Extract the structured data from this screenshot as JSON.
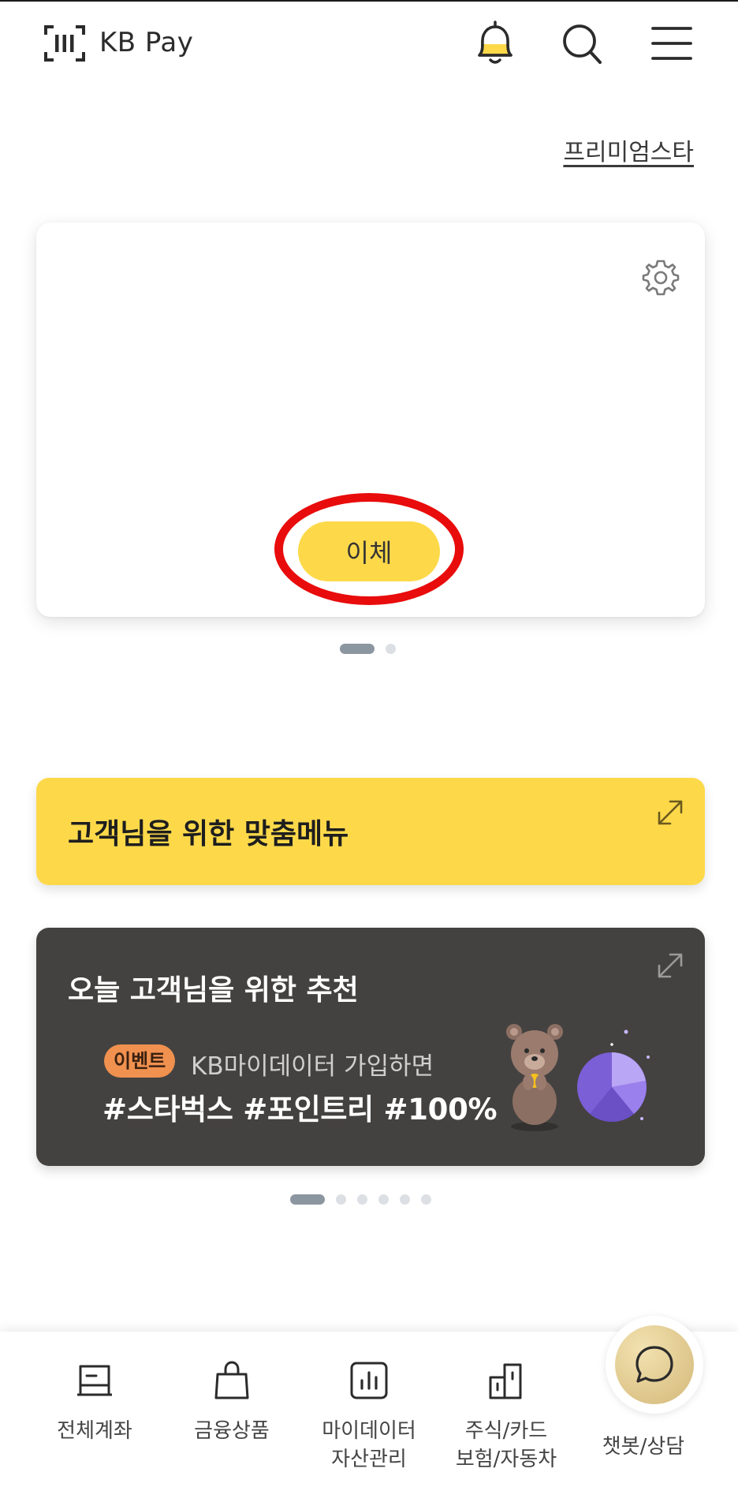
{
  "header": {
    "title": "KB Pay",
    "icons": [
      "barcode-icon",
      "bell-icon",
      "search-icon",
      "hamburger-menu-icon"
    ]
  },
  "premium_link": "프리미엄스타",
  "account_card": {
    "transfer_label": "이체",
    "page_count": 2,
    "active_page": 1
  },
  "custom_menu": {
    "title": "고객님을 위한 맞춤메뉴"
  },
  "recommendation": {
    "title": "오늘 고객님을 위한 추천",
    "badge": "이벤트",
    "text": "KB마이데이터 가입하면",
    "tags": "#스타벅스 #포인트리 #100%",
    "page_count": 6,
    "active_page": 1
  },
  "bottom_nav": [
    {
      "label": "전체계좌",
      "icon": "account-book-icon"
    },
    {
      "label": "금융상품",
      "icon": "shopping-bag-icon"
    },
    {
      "label": "마이데이터\n자산관리",
      "icon": "bar-chart-icon"
    },
    {
      "label": "주식/카드\n보험/자동차",
      "icon": "buildings-icon"
    },
    {
      "label": "챗봇/상담",
      "icon": "chat-bubble-icon"
    }
  ],
  "colors": {
    "brand_yellow": "#FDD94A",
    "dark_card": "#444240",
    "highlight_ring": "#E80C0C",
    "badge_orange": "#F0914F"
  }
}
